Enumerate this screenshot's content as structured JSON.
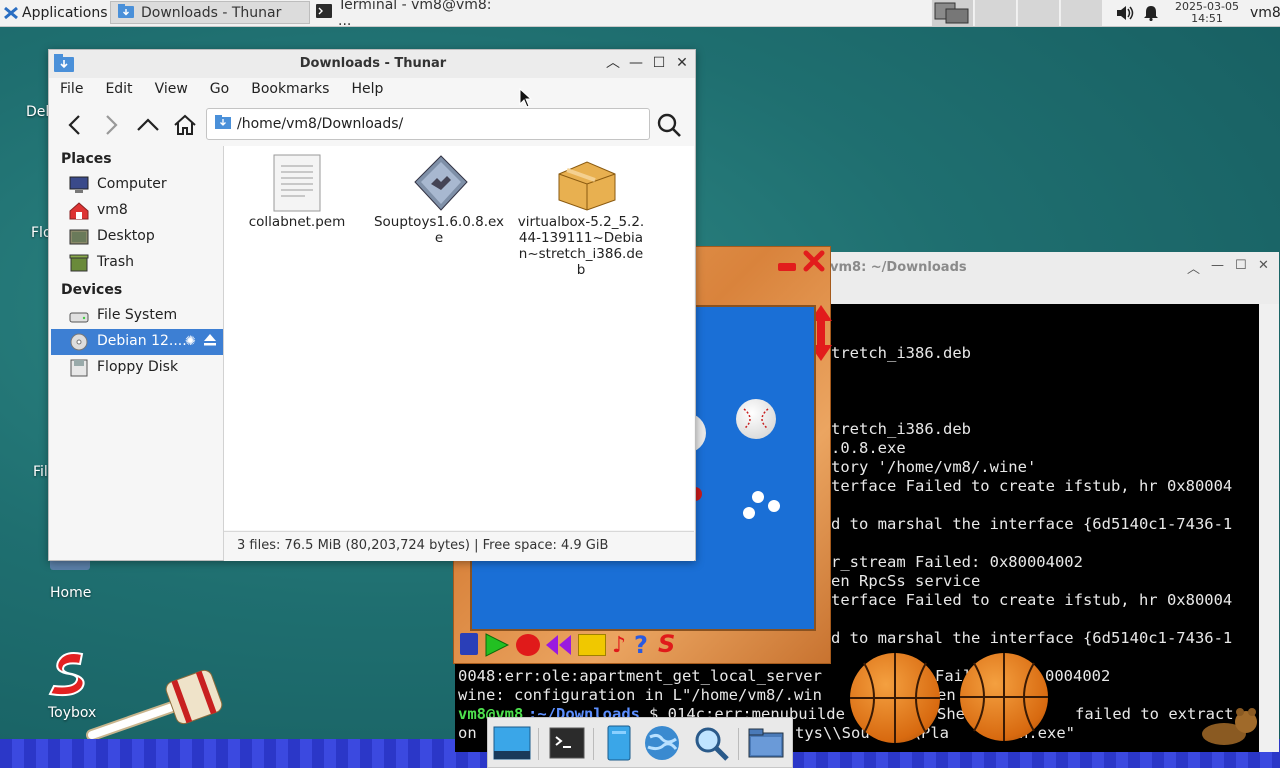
{
  "top_panel": {
    "applications_label": "Applications",
    "tasks": [
      {
        "label": "Downloads - Thunar"
      },
      {
        "label": "Terminal - vm8@vm8: ..."
      }
    ],
    "clock_date": "2025-03-05",
    "clock_time": "14:51",
    "user": "vm8"
  },
  "desktop": {
    "icons": [
      {
        "label": "Del"
      },
      {
        "label": "Flo"
      },
      {
        "label": "Fil"
      },
      {
        "label": "Home"
      },
      {
        "label": "Toybox"
      }
    ]
  },
  "thunar": {
    "title": "Downloads - Thunar",
    "menu": [
      "File",
      "Edit",
      "View",
      "Go",
      "Bookmarks",
      "Help"
    ],
    "location": "/home/vm8/Downloads/",
    "places_header": "Places",
    "places": [
      "Computer",
      "vm8",
      "Desktop",
      "Trash"
    ],
    "devices_header": "Devices",
    "devices": [
      "File System",
      "Debian 12....",
      "Floppy Disk"
    ],
    "files": [
      {
        "name": "collabnet.pem"
      },
      {
        "name": "Souptoys1.6.0.8.exe"
      },
      {
        "name": "virtualbox-5.2_5.2.44-139111~Debian~stretch_i386.deb"
      }
    ],
    "status": "3 files: 76.5 MiB (80,203,724 bytes)  |  Free space: 4.9 GiB"
  },
  "terminal": {
    "title": "vm8: ~/Downloads",
    "lines": [
      "tretch_i386.deb",
      "tretch_i386.deb",
      ".0.8.exe",
      "tory '/home/vm8/.wine'",
      "terface Failed to create ifstub, hr 0x80004",
      "d to marshal the interface {6d5140c1-7436-1",
      "r_stream Failed: 0x80004002",
      "en RpcSs service",
      "terface Failed to create ifstub, hr 0x80004",
      "d to marshal the interface {6d5140c1-7436-1",
      "0048:err:ole:apartment_get_local_server",
      "Fail",
      "0004002",
      "wine: configuration in L\"/home/vm8/.win",
      "en",
      "vm8@vm8",
      ":~/Downloads",
      "$ 014c:err:menubuilde",
      "She",
      "failed to extract",
      "on",
      "tys\\\\Sou",
      "s\\\\Pla",
      "icon.exe\""
    ]
  }
}
